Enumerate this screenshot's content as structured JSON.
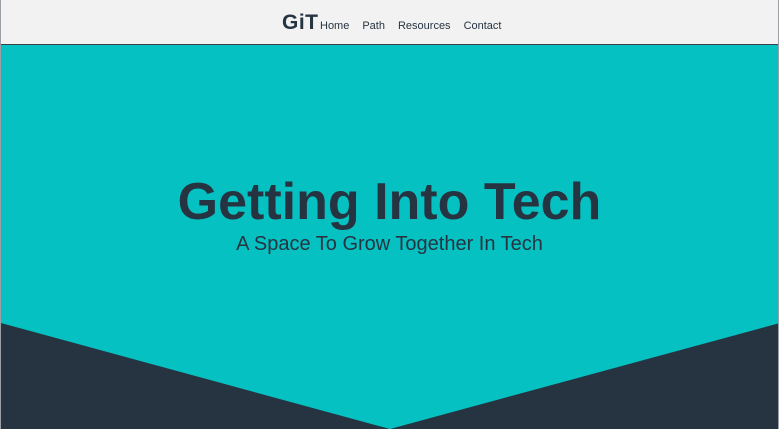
{
  "nav": {
    "logo": "GiT",
    "links": [
      "Home",
      "Path",
      "Resources",
      "Contact"
    ]
  },
  "hero": {
    "title": "Getting Into Tech",
    "subtitle": "A Space To Grow Together In Tech"
  },
  "colors": {
    "nav_background": "#f2f2f2",
    "hero_background": "#06c1c1",
    "text_dark": "#263442",
    "chevron": "#263442"
  }
}
